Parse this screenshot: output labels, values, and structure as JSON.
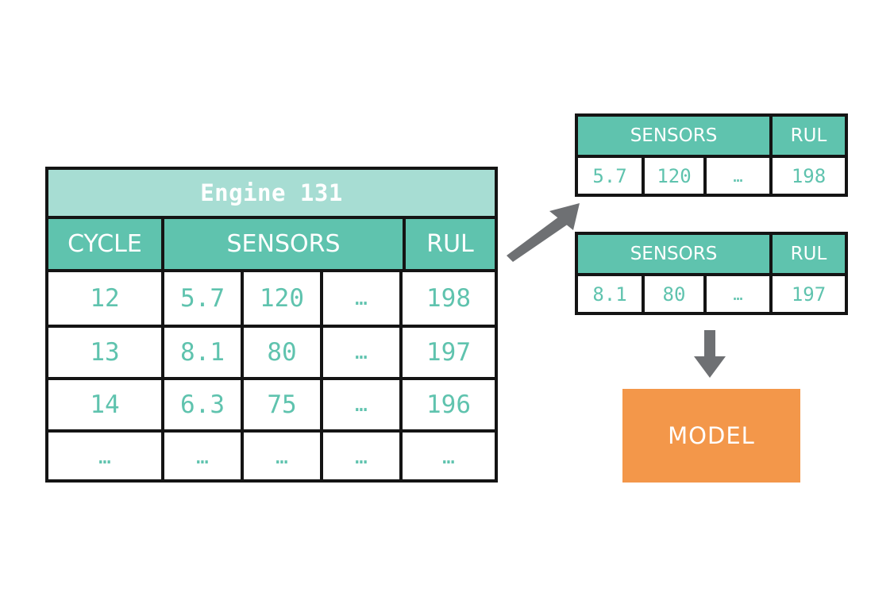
{
  "diagram": {
    "main_table": {
      "title": "Engine 131",
      "headers": [
        "CYCLE",
        "SENSORS",
        "RUL"
      ],
      "rows": [
        {
          "cycle": "12",
          "s1": "5.7",
          "s2": "120",
          "s3": "…",
          "rul": "198"
        },
        {
          "cycle": "13",
          "s1": "8.1",
          "s2": "80",
          "s3": "…",
          "rul": "197"
        },
        {
          "cycle": "14",
          "s1": "6.3",
          "s2": "75",
          "s3": "…",
          "rul": "196"
        },
        {
          "cycle": "…",
          "s1": "…",
          "s2": "…",
          "s3": "…",
          "rul": "…"
        }
      ]
    },
    "sample_tables": [
      {
        "headers": [
          "SENSORS",
          "RUL"
        ],
        "row": {
          "s1": "5.7",
          "s2": "120",
          "s3": "…",
          "rul": "198"
        }
      },
      {
        "headers": [
          "SENSORS",
          "RUL"
        ],
        "row": {
          "s1": "8.1",
          "s2": "80",
          "s3": "…",
          "rul": "197"
        }
      }
    ],
    "model_box": {
      "label": "MODEL"
    },
    "arrows": {
      "diagonal_icon": "arrow-up-right-icon",
      "down_icon": "arrow-down-icon"
    },
    "colors": {
      "title_band": "#a7ddd3",
      "header_teal": "#5fc3ae",
      "data_text": "#5fc3ae",
      "border": "#141414",
      "model_orange": "#f3974a",
      "arrow_gray": "#6e7073",
      "background": "#ffffff"
    }
  }
}
